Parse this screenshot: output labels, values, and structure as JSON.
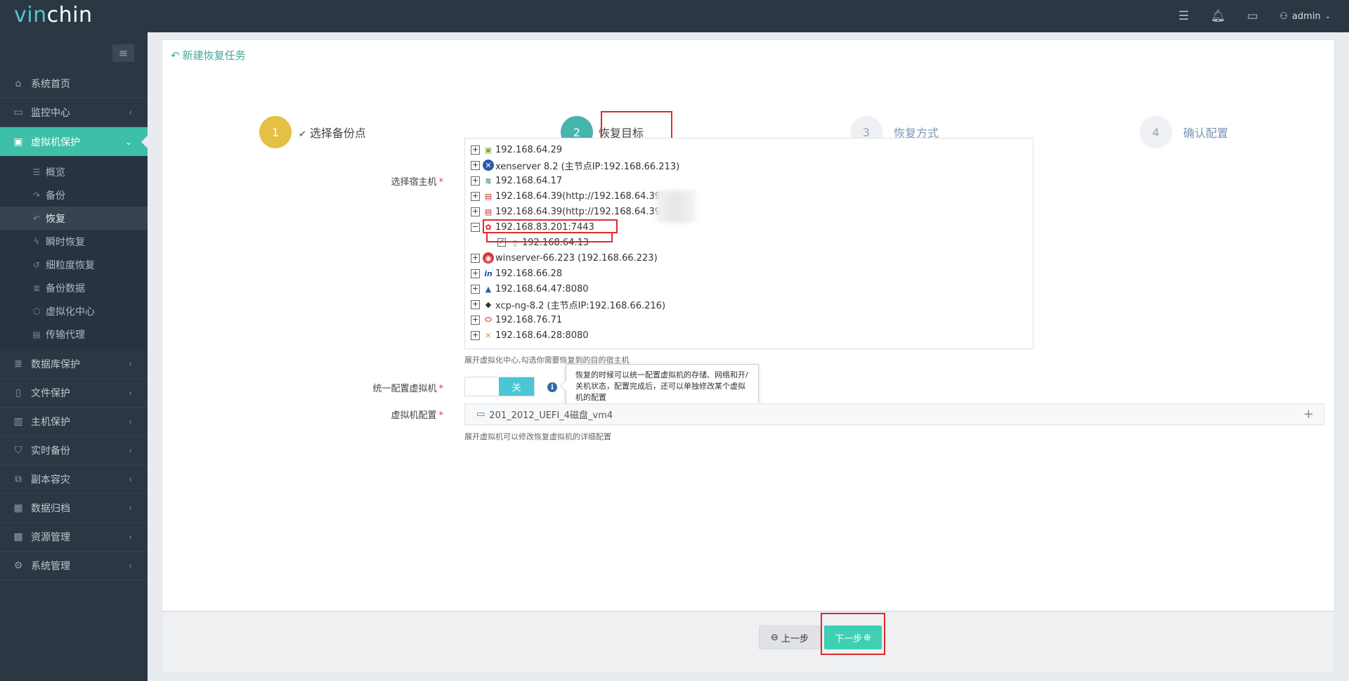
{
  "app": {
    "logo_part1": "vin",
    "logo_part2": "chin",
    "user": "admin"
  },
  "topbar_icons": [
    "list-icon",
    "bell-icon",
    "monitor-icon",
    "user-icon"
  ],
  "sidebar": {
    "items": [
      {
        "label": "系统首页",
        "icon": "home-icon"
      },
      {
        "label": "监控中心",
        "icon": "monitor-icon"
      },
      {
        "label": "虚拟机保护",
        "icon": "desktop-icon"
      },
      {
        "label": "数据库保护",
        "icon": "database-icon"
      },
      {
        "label": "文件保护",
        "icon": "file-icon"
      },
      {
        "label": "主机保护",
        "icon": "server-icon"
      },
      {
        "label": "实时备份",
        "icon": "shield-icon"
      },
      {
        "label": "副本容灾",
        "icon": "copy-icon"
      },
      {
        "label": "数据归档",
        "icon": "archive-icon"
      },
      {
        "label": "资源管理",
        "icon": "grid-icon"
      },
      {
        "label": "系统管理",
        "icon": "gear-icon"
      }
    ],
    "sub_items": [
      {
        "label": "概览",
        "icon": "list-icon"
      },
      {
        "label": "备份",
        "icon": "share-icon"
      },
      {
        "label": "恢复",
        "icon": "reply-icon"
      },
      {
        "label": "瞬时恢复",
        "icon": "bolt-icon"
      },
      {
        "label": "细粒度恢复",
        "icon": "undo-icon"
      },
      {
        "label": "备份数据",
        "icon": "database-icon"
      },
      {
        "label": "虚拟化中心",
        "icon": "cube-icon"
      },
      {
        "label": "传输代理",
        "icon": "doc-icon"
      }
    ]
  },
  "page": {
    "title": "新建恢复任务"
  },
  "steps": [
    {
      "num": "1",
      "label": "选择备份点"
    },
    {
      "num": "2",
      "label": "恢复目标"
    },
    {
      "num": "3",
      "label": "恢复方式"
    },
    {
      "num": "4",
      "label": "确认配置"
    }
  ],
  "form": {
    "host_label": "选择宿主机",
    "host_help": "展开虚拟化中心,勾选你需要恢复到的目的宿主机",
    "unify_label": "统一配置虚拟机",
    "switch_off": "关",
    "tooltip": "恢复的时候可以统一配置虚拟机的存储、网络和开/关机状态，配置完成后，还可以单独修改某个虚拟机的配置",
    "vm_label": "虚拟机配置",
    "vm_name": "201_2012_UEFI_4磁盘_vm4",
    "vm_help": "展开虚拟机可以修改恢复虚拟机的详细配置",
    "required_mark": "*"
  },
  "tree": [
    {
      "text": "192.168.64.29",
      "icon_color": "#7cb32b",
      "glyph": "▣",
      "expanded": false
    },
    {
      "text": "xenserver 8.2 (主节点IP:192.168.66.213)",
      "icon_color": "#2a5aa8",
      "glyph": "✕",
      "expanded": false
    },
    {
      "text": "192.168.64.17",
      "icon_color": "#2b8a4a",
      "glyph": "≋",
      "expanded": false
    },
    {
      "text": "192.168.64.39(http://192.168.64.39)",
      "icon_color": "#d42a2a",
      "glyph": "▤",
      "expanded": false
    },
    {
      "text": "192.168.64.39(http://192.168.64.39)",
      "icon_color": "#d42a2a",
      "glyph": "▤",
      "expanded": false
    },
    {
      "text": "192.168.83.201:7443",
      "icon_color": "#e02020",
      "glyph": "✿",
      "expanded": true
    },
    {
      "text": "winserver-66.223 (192.168.66.223)",
      "icon_color": "#d33a3a",
      "glyph": "◉",
      "expanded": false
    },
    {
      "text": "192.168.66.28",
      "icon_color": "#1f4fa8",
      "glyph": "in",
      "expanded": false
    },
    {
      "text": "192.168.64.47:8080",
      "icon_color": "#2a5fa8",
      "glyph": "▲",
      "expanded": false
    },
    {
      "text": "xcp-ng-8.2 (主节点IP:192.168.66.216)",
      "icon_color": "#333333",
      "glyph": "◆",
      "expanded": false
    },
    {
      "text": "192.168.76.71",
      "icon_color": "#d42020",
      "glyph": "⬭",
      "expanded": false
    },
    {
      "text": "192.168.64.28:8080",
      "icon_color": "#e2a020",
      "glyph": "✕",
      "expanded": false
    }
  ],
  "tree_child": {
    "text": "192.168.64.13",
    "checked": "✓"
  },
  "buttons": {
    "prev": "上一步",
    "next": "下一步"
  },
  "colors": {
    "accent": "#3dbfa9",
    "sidebar_bg": "#2c3744",
    "step_done": "#e6bf45",
    "step_current": "#47b4ad",
    "highlight_box": "#e02b2b"
  }
}
